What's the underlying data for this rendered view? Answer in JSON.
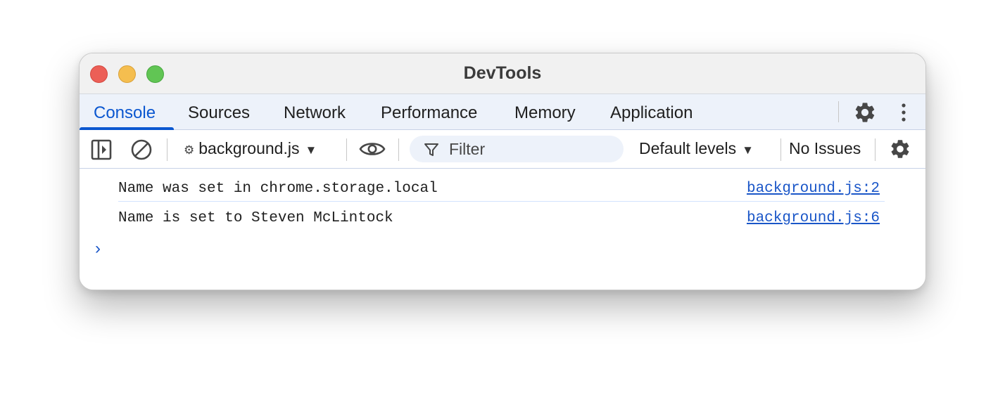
{
  "window": {
    "title": "DevTools"
  },
  "tabs": [
    {
      "label": "Console",
      "active": true
    },
    {
      "label": "Sources"
    },
    {
      "label": "Network"
    },
    {
      "label": "Performance"
    },
    {
      "label": "Memory"
    },
    {
      "label": "Application"
    }
  ],
  "toolbar": {
    "context": "background.js",
    "filter_placeholder": "Filter",
    "levels": "Default levels",
    "issues": "No Issues"
  },
  "console": {
    "messages": [
      {
        "text": "Name was set in chrome.storage.local",
        "source": "background.js:2"
      },
      {
        "text": "Name is set to Steven McLintock",
        "source": "background.js:6"
      }
    ],
    "prompt": "›"
  },
  "icons": {
    "sidebar": "sidebar-toggle-icon",
    "clear": "clear-console-icon",
    "eye": "live-expression-eye-icon",
    "filter": "filter-funnel-icon",
    "settings": "gear-icon",
    "more": "kebab-menu-icon"
  },
  "colors": {
    "accent": "#0b57d0",
    "link": "#1a56c8",
    "tabbar_bg": "#edf2fa"
  }
}
